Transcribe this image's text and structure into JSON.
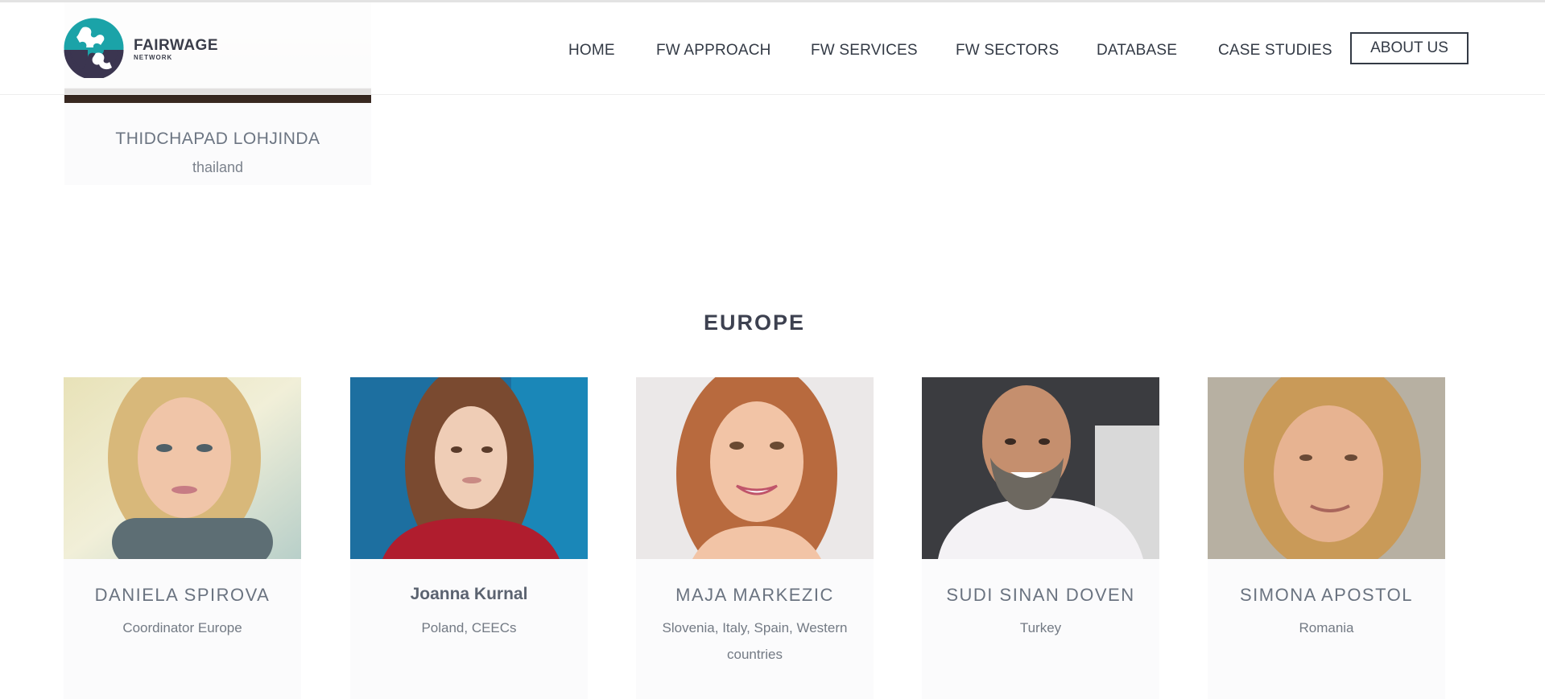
{
  "brand": {
    "title": "FAIRWAGE",
    "subtitle": "NETWORK",
    "colors": {
      "teal": "#1ba3a8",
      "dark": "#3b3550"
    }
  },
  "nav": {
    "items": [
      "HOME",
      "FW APPROACH",
      "FW SERVICES",
      "FW SECTORS",
      "DATABASE",
      "CASE STUDIES"
    ],
    "about": "ABOUT US"
  },
  "previous_member": {
    "name": "THIDCHAPAD LOHJINDA",
    "country": "thailand"
  },
  "section": {
    "title": "EUROPE"
  },
  "members": [
    {
      "name": "DANIELA SPIROVA",
      "role": "Coordinator Europe",
      "photo": "portrait-blonde-woman-icon"
    },
    {
      "name": "Joanna Kurnal",
      "role": "Poland, CEECs",
      "photo": "portrait-brown-haired-woman-icon"
    },
    {
      "name": "MAJA MARKEZIC",
      "role": "Slovenia, Italy, Spain, Western countries",
      "photo": "portrait-smiling-woman-icon"
    },
    {
      "name": "SUDI SINAN DOVEN",
      "role": "Turkey",
      "photo": "portrait-bearded-man-icon"
    },
    {
      "name": "SIMONA APOSTOL",
      "role": "Romania",
      "photo": "portrait-woman-icon"
    }
  ]
}
